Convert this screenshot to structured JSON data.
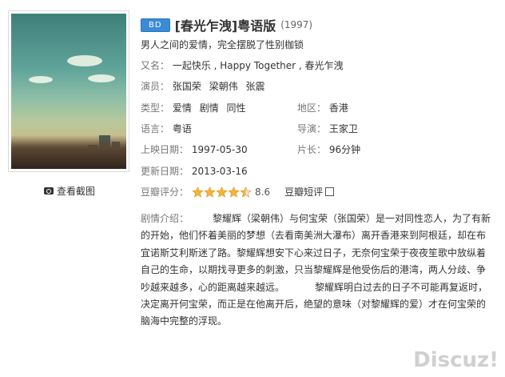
{
  "poster": {
    "alt": "电影海报"
  },
  "screenshots_label": "查看截图",
  "badge": "BD",
  "title": "[春光乍洩]粤语版",
  "year": "(1997)",
  "tagline": "男人之间的爱情，完全摆脱了性别枷锁",
  "aka": {
    "label": "又名：",
    "value": "一起快乐 , Happy Together , 春光乍洩"
  },
  "cast": {
    "label": "演员：",
    "names": [
      "张国荣",
      "梁朝伟",
      "张震"
    ]
  },
  "genre": {
    "label": "类型：",
    "names": [
      "爱情",
      "剧情",
      "同性"
    ]
  },
  "region": {
    "label": "地区：",
    "value": "香港"
  },
  "language": {
    "label": "语言：",
    "value": "粤语"
  },
  "director": {
    "label": "导演：",
    "value": "王家卫"
  },
  "release": {
    "label": "上映日期：",
    "value": "1997-05-30"
  },
  "length": {
    "label": "片长：",
    "value": "96分钟"
  },
  "updated": {
    "label": "更新日期：",
    "value": "2013-03-16"
  },
  "rating": {
    "label": "豆瓣评分：",
    "score": "8.6",
    "stars": 4.5,
    "star_color": "#f4b43c",
    "link": "豆瓣短评"
  },
  "synopsis": {
    "label": "剧情介绍：",
    "text": "黎耀辉（梁朝伟）与何宝荣（张国荣）是一对同性恋人，为了有新的开始，他们怀着美丽的梦想（去看南美洲大瀑布）离开香港来到阿根廷，却在布宜诺斯艾利斯迷了路。黎耀辉想安下心来过日子，无奈何宝荣于夜夜笙歌中放纵着自己的生命，以期找寻更多的刺激，只当黎耀辉是他受伤后的港湾，两人分歧、争吵越来越多，心的距离越来越远。",
    "text2": "黎耀辉明白过去的日子不可能再复返时，决定离开何宝荣，而正是在他离开后，绝望的意味（对黎耀辉的爱）才在何宝荣的脑海中完整的浮现。"
  },
  "watermark": {
    "brand": "Discuz!"
  }
}
